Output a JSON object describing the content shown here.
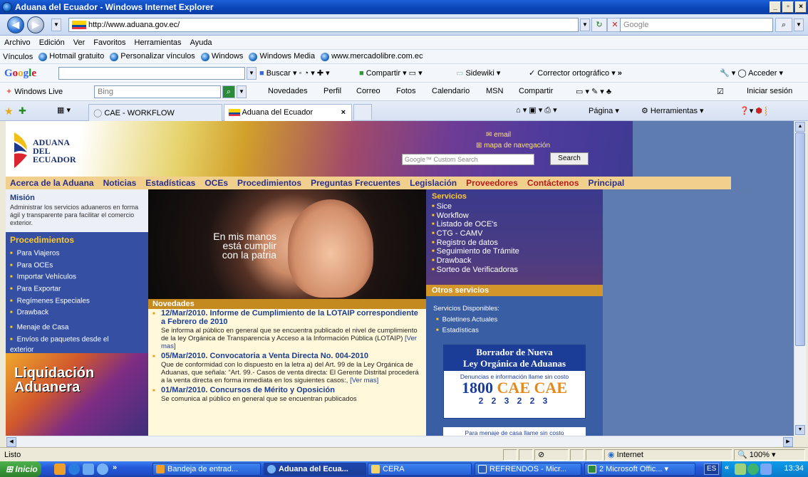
{
  "window": {
    "title": "Aduana del Ecuador - Windows Internet Explorer",
    "controls": [
      "_",
      "4",
      "×"
    ]
  },
  "address": {
    "url": "http://www.aduana.gov.ec/",
    "search_placeholder": "Google"
  },
  "menu": [
    "Archivo",
    "Edición",
    "Ver",
    "Favoritos",
    "Herramientas",
    "Ayuda"
  ],
  "links": {
    "label": "Vínculos",
    "items": [
      "Hotmail gratuito",
      "Personalizar vínculos",
      "Windows",
      "Windows Media",
      "www.mercadolibre.com.ec"
    ]
  },
  "gtoolbar": {
    "logo": "Google",
    "buscar": "Buscar",
    "compartir": "Compartir",
    "sidewiki": "Sidewiki",
    "corrector": "Corrector ortográfico",
    "acceder": "Acceder"
  },
  "wlbar": {
    "live": "Windows Live",
    "bing": "Bing",
    "items": [
      "Novedades",
      "Perfil",
      "Correo",
      "Fotos",
      "Calendario",
      "MSN",
      "Compartir"
    ],
    "signin": "Iniciar sesión"
  },
  "tabs": [
    {
      "label": "CAE - WORKFLOW"
    },
    {
      "label": "Aduana del Ecuador"
    }
  ],
  "cmdbar": {
    "pagina": "Página",
    "herramientas": "Herramientas"
  },
  "page": {
    "logo": {
      "line1": "ADUANA",
      "line2": "DEL",
      "line3": "ECUADOR"
    },
    "header_links": {
      "email": "email",
      "map": "mapa de navegación"
    },
    "search": {
      "placeholder": "Google™ Custom Search",
      "button": "Search"
    },
    "nav": [
      "Acerca de la Aduana",
      "Noticias",
      "Estadísticas",
      "OCEs",
      "Procedimientos",
      "Preguntas Frecuentes",
      "Legislación",
      "Proveedores",
      "Contáctenos",
      "Principal"
    ],
    "mision": {
      "title": "Misión",
      "text": "Administrar los servicios aduaneros en forma ágil y transparente para facilitar el comercio exterior."
    },
    "procedimientos": {
      "title": "Procedimientos",
      "items": [
        "Para Viajeros",
        "Para OCEs",
        "Importar Vehículos",
        "Para Exportar",
        "Regímenes Especiales",
        "Drawback",
        "Menaje de Casa",
        "Envíos de paquetes desde el exterior"
      ]
    },
    "liquidacion": {
      "line1": "Liquidación",
      "line2": "Aduanera"
    },
    "photo_caption": {
      "line1": "En mis manos",
      "line2": "está cumplir",
      "line3": "con la patria"
    },
    "novedades": {
      "title": "Novedades",
      "items": [
        {
          "title": "12/Mar/2010. Informe de Cumplimiento de la LOTAIP correspondiente a Febrero de 2010",
          "body": "Se informa al público en general que se encuentra publicado el nivel de cumplimiento de la ley Orgánica de Transparencia y Acceso a la Información Pública (LOTAIP)",
          "more": "[Ver mas]"
        },
        {
          "title": "05/Mar/2010. Convocatoria a Venta Directa No. 004-2010",
          "body": "Que de conformidad con lo dispuesto en la letra a) del Art. 99 de la Ley Orgánica de Aduanas, que señala: “Art. 99.- Casos de venta directa: El Gerente Distrital procederá a la venta directa en forma inmediata en los siguientes casos:,",
          "more": "[Ver mas]"
        },
        {
          "title": "01/Mar/2010. Concursos de Mérito y Oposición",
          "body": "Se comunica al público en general que se encuentran publicados",
          "more": ""
        }
      ]
    },
    "servicios": {
      "title": "Servicios",
      "items": [
        "Sice",
        "Workflow",
        "Listado de OCE's",
        "CTG - CAMV",
        "Registro de datos",
        "Seguimiento de Trámite",
        "Drawback",
        "Sorteo de Verificadoras"
      ]
    },
    "otros": {
      "title": "Otros servicios",
      "disp": "Servicios Disponibles:",
      "items": [
        "Boletines Actuales",
        "Estadísticas"
      ]
    },
    "banner": {
      "title1": "Borrador de Nueva",
      "title2": "Ley Orgánica de Aduanas",
      "denuncias": "Denuncias e información llame sin costo",
      "num_a": "1800 ",
      "num_b": "CAE CAE",
      "digits": "2 2 3 2 2 3",
      "menaje": "Para menaje de casa llame sin costo"
    }
  },
  "status": {
    "text": "Listo",
    "zone": "Internet",
    "zoom": "100%"
  },
  "taskbar": {
    "start": "Inicio",
    "tasks": [
      "Bandeja de entrad...",
      "Aduana del Ecua...",
      "CERA",
      "REFRENDOS - Micr...",
      "2 Microsoft Offic..."
    ],
    "lang": "ES",
    "time": "13:34"
  }
}
